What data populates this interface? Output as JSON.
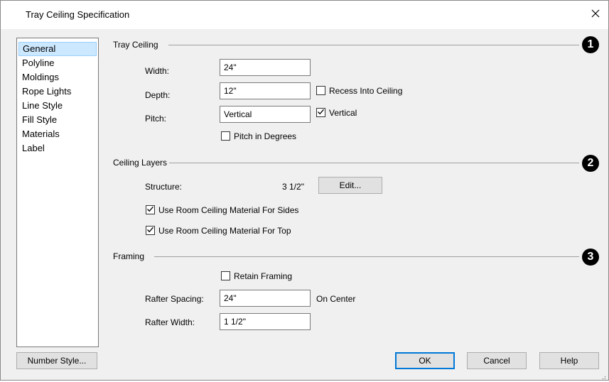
{
  "window": {
    "title": "Tray Ceiling Specification"
  },
  "nav": {
    "items": [
      "General",
      "Polyline",
      "Moldings",
      "Rope Lights",
      "Line Style",
      "Fill Style",
      "Materials",
      "Label"
    ],
    "selected": "General"
  },
  "tray_ceiling": {
    "title": "Tray Ceiling",
    "badge": "1",
    "width_label": "Width:",
    "width_value": "24\"",
    "depth_label": "Depth:",
    "depth_value": "12\"",
    "recess_label": "Recess Into Ceiling",
    "recess_checked": false,
    "pitch_label": "Pitch:",
    "pitch_value": "Vertical",
    "vertical_label": "Vertical",
    "vertical_checked": true,
    "pitch_degrees_label": "Pitch in Degrees",
    "pitch_degrees_checked": false
  },
  "ceiling_layers": {
    "title": "Ceiling Layers",
    "badge": "2",
    "structure_label": "Structure:",
    "structure_value": "3 1/2\"",
    "edit_button": "Edit...",
    "sides_label": "Use Room Ceiling Material For Sides",
    "sides_checked": true,
    "top_label": "Use Room Ceiling Material For Top",
    "top_checked": true
  },
  "framing": {
    "title": "Framing",
    "badge": "3",
    "retain_label": "Retain Framing",
    "retain_checked": false,
    "spacing_label": "Rafter Spacing:",
    "spacing_value": "24\"",
    "on_center_label": "On Center",
    "width_label": "Rafter Width:",
    "width_value": "1 1/2\""
  },
  "footer": {
    "number_style": "Number Style...",
    "ok": "OK",
    "cancel": "Cancel",
    "help": "Help"
  }
}
